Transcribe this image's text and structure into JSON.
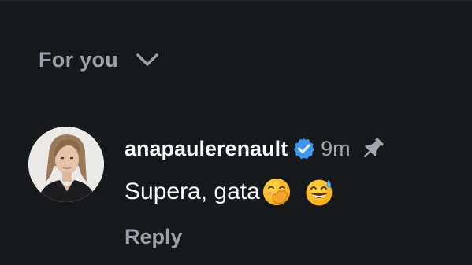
{
  "sort": {
    "label": "For you",
    "icon": "chevron-down-icon"
  },
  "comment": {
    "username": "anapaulerenault",
    "verified_icon": "verified-badge-icon",
    "time": "9m",
    "pin_icon": "pin-icon",
    "text": "Supera, gata",
    "emojis": [
      "face-with-hand-over-mouth-emoji",
      "grinning-face-with-sweat-emoji"
    ],
    "reply_label": "Reply"
  },
  "colors": {
    "background": "#16191c",
    "muted_text": "#9ba1a8",
    "primary_text": "#ffffff",
    "verified_blue": "#3897f0"
  }
}
